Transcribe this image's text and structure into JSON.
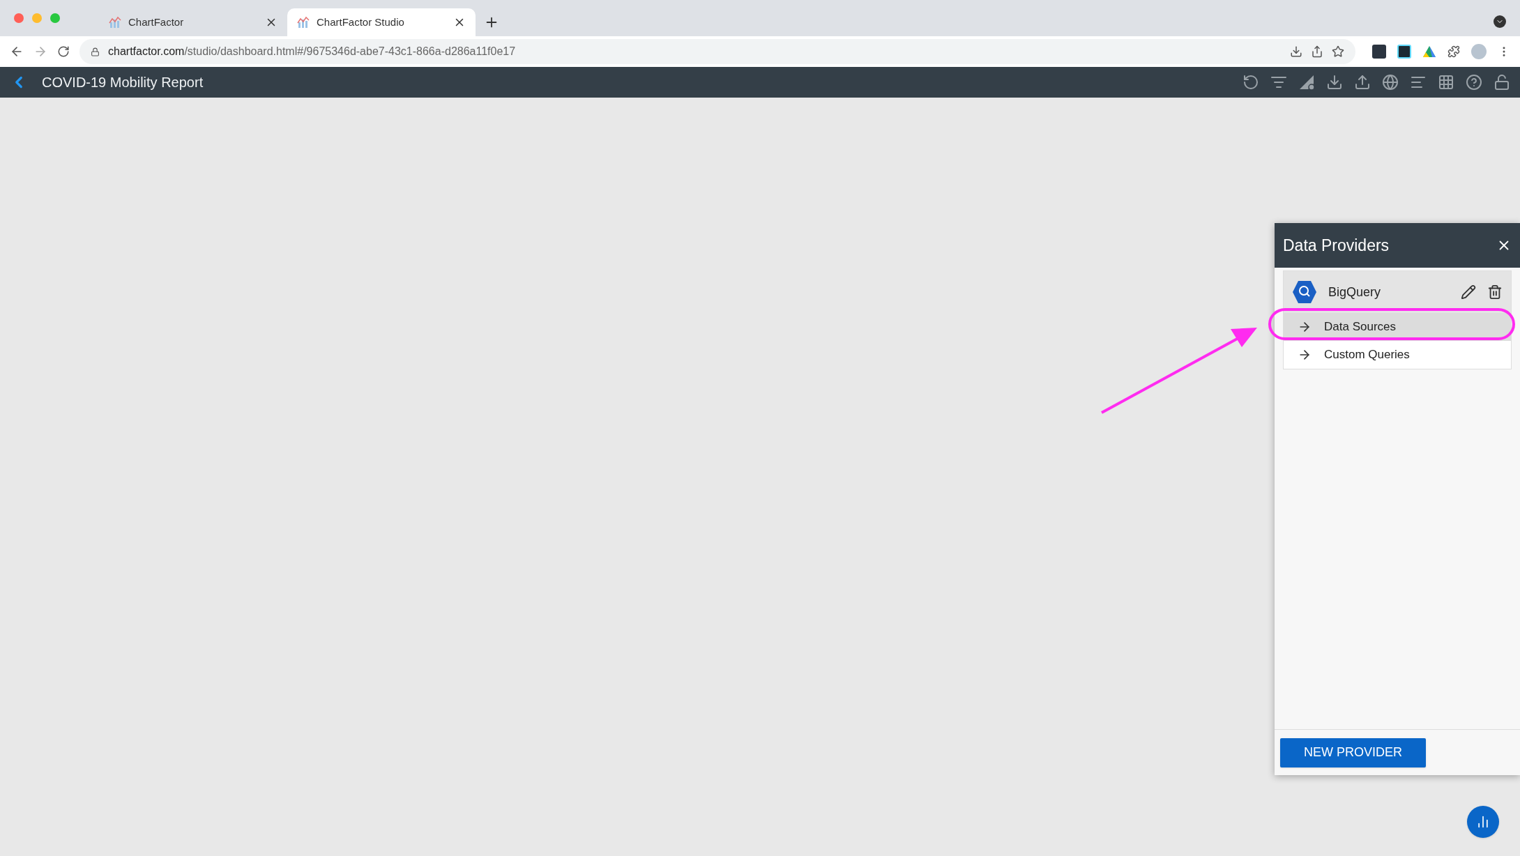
{
  "browser": {
    "tabs": [
      {
        "title": "ChartFactor",
        "selected": false
      },
      {
        "title": "ChartFactor Studio",
        "selected": true
      }
    ],
    "url_host": "chartfactor.com",
    "url_path": "/studio/dashboard.html#/9675346d-abe7-43c1-866a-d286a11f0e17"
  },
  "app_bar": {
    "title": "COVID-19 Mobility Report"
  },
  "panel": {
    "title": "Data Providers",
    "provider": {
      "name": "BigQuery"
    },
    "items": [
      {
        "label": "Data Sources",
        "selected": true
      },
      {
        "label": "Custom Queries",
        "selected": false
      }
    ],
    "button": "NEW PROVIDER"
  }
}
